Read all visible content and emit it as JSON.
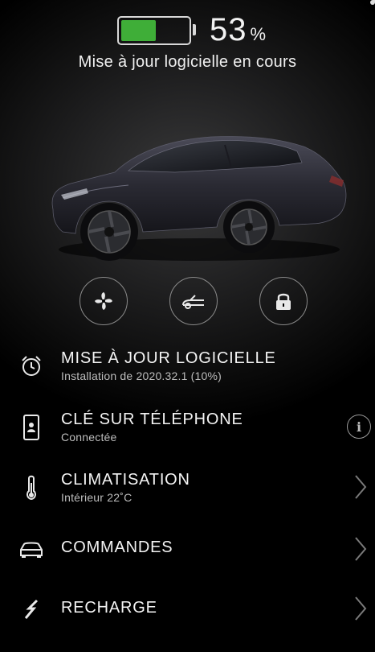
{
  "battery": {
    "percent_value": 53,
    "percent_text": "53",
    "percent_sign": "%",
    "fill_color": "#3fae38"
  },
  "status": {
    "text": "Mise à jour logicielle en cours"
  },
  "actions": [
    {
      "name": "fan-icon"
    },
    {
      "name": "frunk-icon"
    },
    {
      "name": "lock-icon"
    }
  ],
  "menu": {
    "software": {
      "title": "MISE À JOUR LOGICIELLE",
      "subtitle": "Installation de 2020.32.1 (10%)",
      "icon": "alarm-clock-icon"
    },
    "phone_key": {
      "title": "CLÉ SUR TÉLÉPHONE",
      "subtitle": "Connectée",
      "icon": "phone-key-icon",
      "info": "i"
    },
    "climate": {
      "title": "CLIMATISATION",
      "subtitle": "Intérieur 22˚C",
      "icon": "thermometer-icon"
    },
    "controls": {
      "title": "COMMANDES",
      "icon": "car-icon"
    },
    "charging": {
      "title": "RECHARGE",
      "icon": "lightning-icon"
    }
  }
}
